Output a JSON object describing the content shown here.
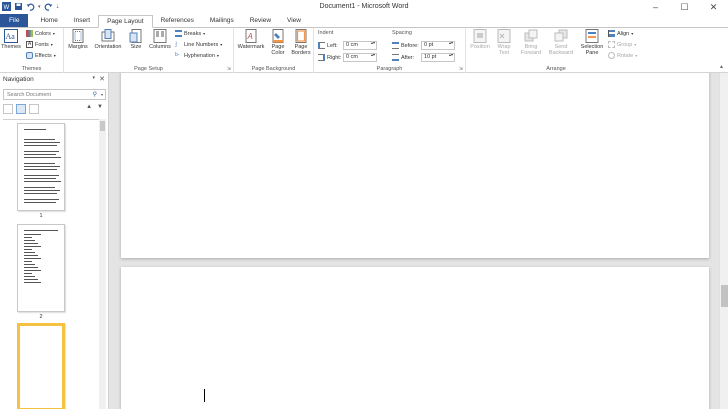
{
  "window": {
    "title": "Document1 - Microsoft Word"
  },
  "qat": {
    "save_icon": "save-icon",
    "undo_icon": "undo-icon",
    "redo_icon": "redo-icon"
  },
  "tabs": [
    {
      "label": "File"
    },
    {
      "label": "Home"
    },
    {
      "label": "Insert"
    },
    {
      "label": "Page Layout"
    },
    {
      "label": "References"
    },
    {
      "label": "Mailings"
    },
    {
      "label": "Review"
    },
    {
      "label": "View"
    }
  ],
  "ribbon": {
    "themes": {
      "themes_label": "Themes",
      "colors_label": "Colors",
      "fonts_label": "Fonts",
      "effects_label": "Effects",
      "group_label": "Themes"
    },
    "page_setup": {
      "margins_label": "Margins",
      "orientation_label": "Orientation",
      "size_label": "Size",
      "columns_label": "Columns",
      "breaks_label": "Breaks",
      "line_numbers_label": "Line Numbers",
      "hyphenation_label": "Hyphenation",
      "group_label": "Page Setup"
    },
    "page_background": {
      "watermark_label": "Watermark",
      "page_color_label1": "Page",
      "page_color_label2": "Color",
      "page_borders_label1": "Page",
      "page_borders_label2": "Borders",
      "group_label": "Page Background"
    },
    "paragraph": {
      "indent_label": "Indent",
      "left_label": "Left:",
      "left_value": "0 cm",
      "right_label": "Right:",
      "right_value": "0 cm",
      "spacing_label": "Spacing",
      "before_label": "Before:",
      "before_value": "0 pt",
      "after_label": "After:",
      "after_value": "10 pt",
      "group_label": "Paragraph"
    },
    "arrange": {
      "position_label": "Position",
      "wrap_label1": "Wrap",
      "wrap_label2": "Text",
      "bring_label1": "Bring",
      "bring_label2": "Forward",
      "send_label1": "Send",
      "send_label2": "Backward",
      "selection_label1": "Selection",
      "selection_label2": "Pane",
      "align_label": "Align",
      "group_btn_label": "Group",
      "rotate_label": "Rotate",
      "group_label": "Arrange"
    }
  },
  "navigation": {
    "title": "Navigation",
    "search_placeholder": "Search Document",
    "pages": [
      {
        "number": "1"
      },
      {
        "number": "2"
      }
    ]
  }
}
